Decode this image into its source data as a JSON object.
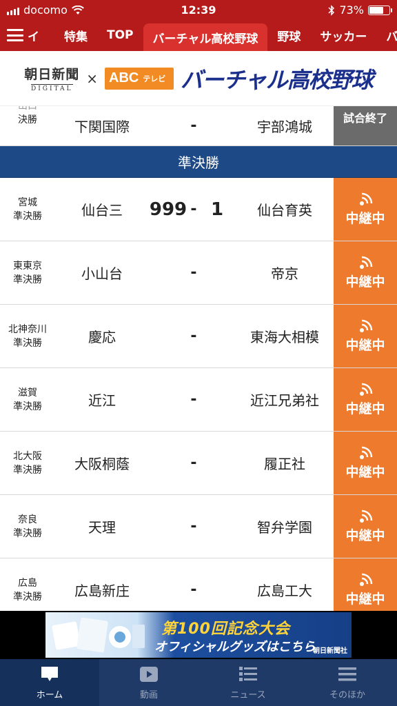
{
  "status_bar": {
    "carrier": "docomo",
    "time": "12:39",
    "battery": "73%",
    "battery_level": 0.73
  },
  "nav": {
    "menu_label": "イ",
    "tabs": [
      {
        "label": "特集"
      },
      {
        "label": "TOP"
      },
      {
        "label": "バーチャル高校野球",
        "active": true
      },
      {
        "label": "野球"
      },
      {
        "label": "サッカー"
      },
      {
        "label": "バレ"
      }
    ]
  },
  "banner": {
    "asahi_main": "朝日新聞",
    "asahi_sub": "DIGITAL",
    "cross": "×",
    "abc_main": "ABC",
    "abc_sub": "テレビ",
    "title": "バーチャル高校野球"
  },
  "partial_row": {
    "region_top": "山口",
    "region_bottom": "決勝",
    "home": "下関国際",
    "dash": "-",
    "away": "宇部鴻城",
    "status": "試合終了"
  },
  "section": {
    "title": "準決勝"
  },
  "rows": [
    {
      "region": "宮城",
      "round": "準決勝",
      "home": "仙台三",
      "home_score": "999",
      "dash": "-",
      "away_score": "1",
      "away": "仙台育英",
      "status": "中継中"
    },
    {
      "region": "東東京",
      "round": "準決勝",
      "home": "小山台",
      "home_score": "",
      "dash": "-",
      "away_score": "",
      "away": "帝京",
      "status": "中継中"
    },
    {
      "region": "北神奈川",
      "round": "準決勝",
      "home": "慶応",
      "home_score": "",
      "dash": "-",
      "away_score": "",
      "away": "東海大相模",
      "status": "中継中"
    },
    {
      "region": "滋賀",
      "round": "準決勝",
      "home": "近江",
      "home_score": "",
      "dash": "-",
      "away_score": "",
      "away": "近江兄弟社",
      "status": "中継中"
    },
    {
      "region": "北大阪",
      "round": "準決勝",
      "home": "大阪桐蔭",
      "home_score": "",
      "dash": "-",
      "away_score": "",
      "away": "履正社",
      "status": "中継中"
    },
    {
      "region": "奈良",
      "round": "準決勝",
      "home": "天理",
      "home_score": "",
      "dash": "-",
      "away_score": "",
      "away": "智弁学園",
      "status": "中継中"
    },
    {
      "region": "広島",
      "round": "準決勝",
      "home": "広島新庄",
      "home_score": "",
      "dash": "-",
      "away_score": "",
      "away": "広島工大",
      "status": "中継中"
    }
  ],
  "ad": {
    "line1": "第100回記念大会",
    "line2": "オフィシャルグッズはこちら",
    "brand": "朝日新聞社"
  },
  "tabbar": {
    "items": [
      {
        "label": "ホーム",
        "icon": "home-icon",
        "active": true
      },
      {
        "label": "動画",
        "icon": "play-icon"
      },
      {
        "label": "ニュース",
        "icon": "news-icon"
      },
      {
        "label": "そのほか",
        "icon": "menu-icon"
      }
    ]
  },
  "colors": {
    "nav_red": "#b51b1b",
    "section_blue": "#1d4a86",
    "live_orange": "#ee7a2d",
    "ended_gray": "#6b6b6b",
    "tabbar_navy": "#1f3a66"
  }
}
